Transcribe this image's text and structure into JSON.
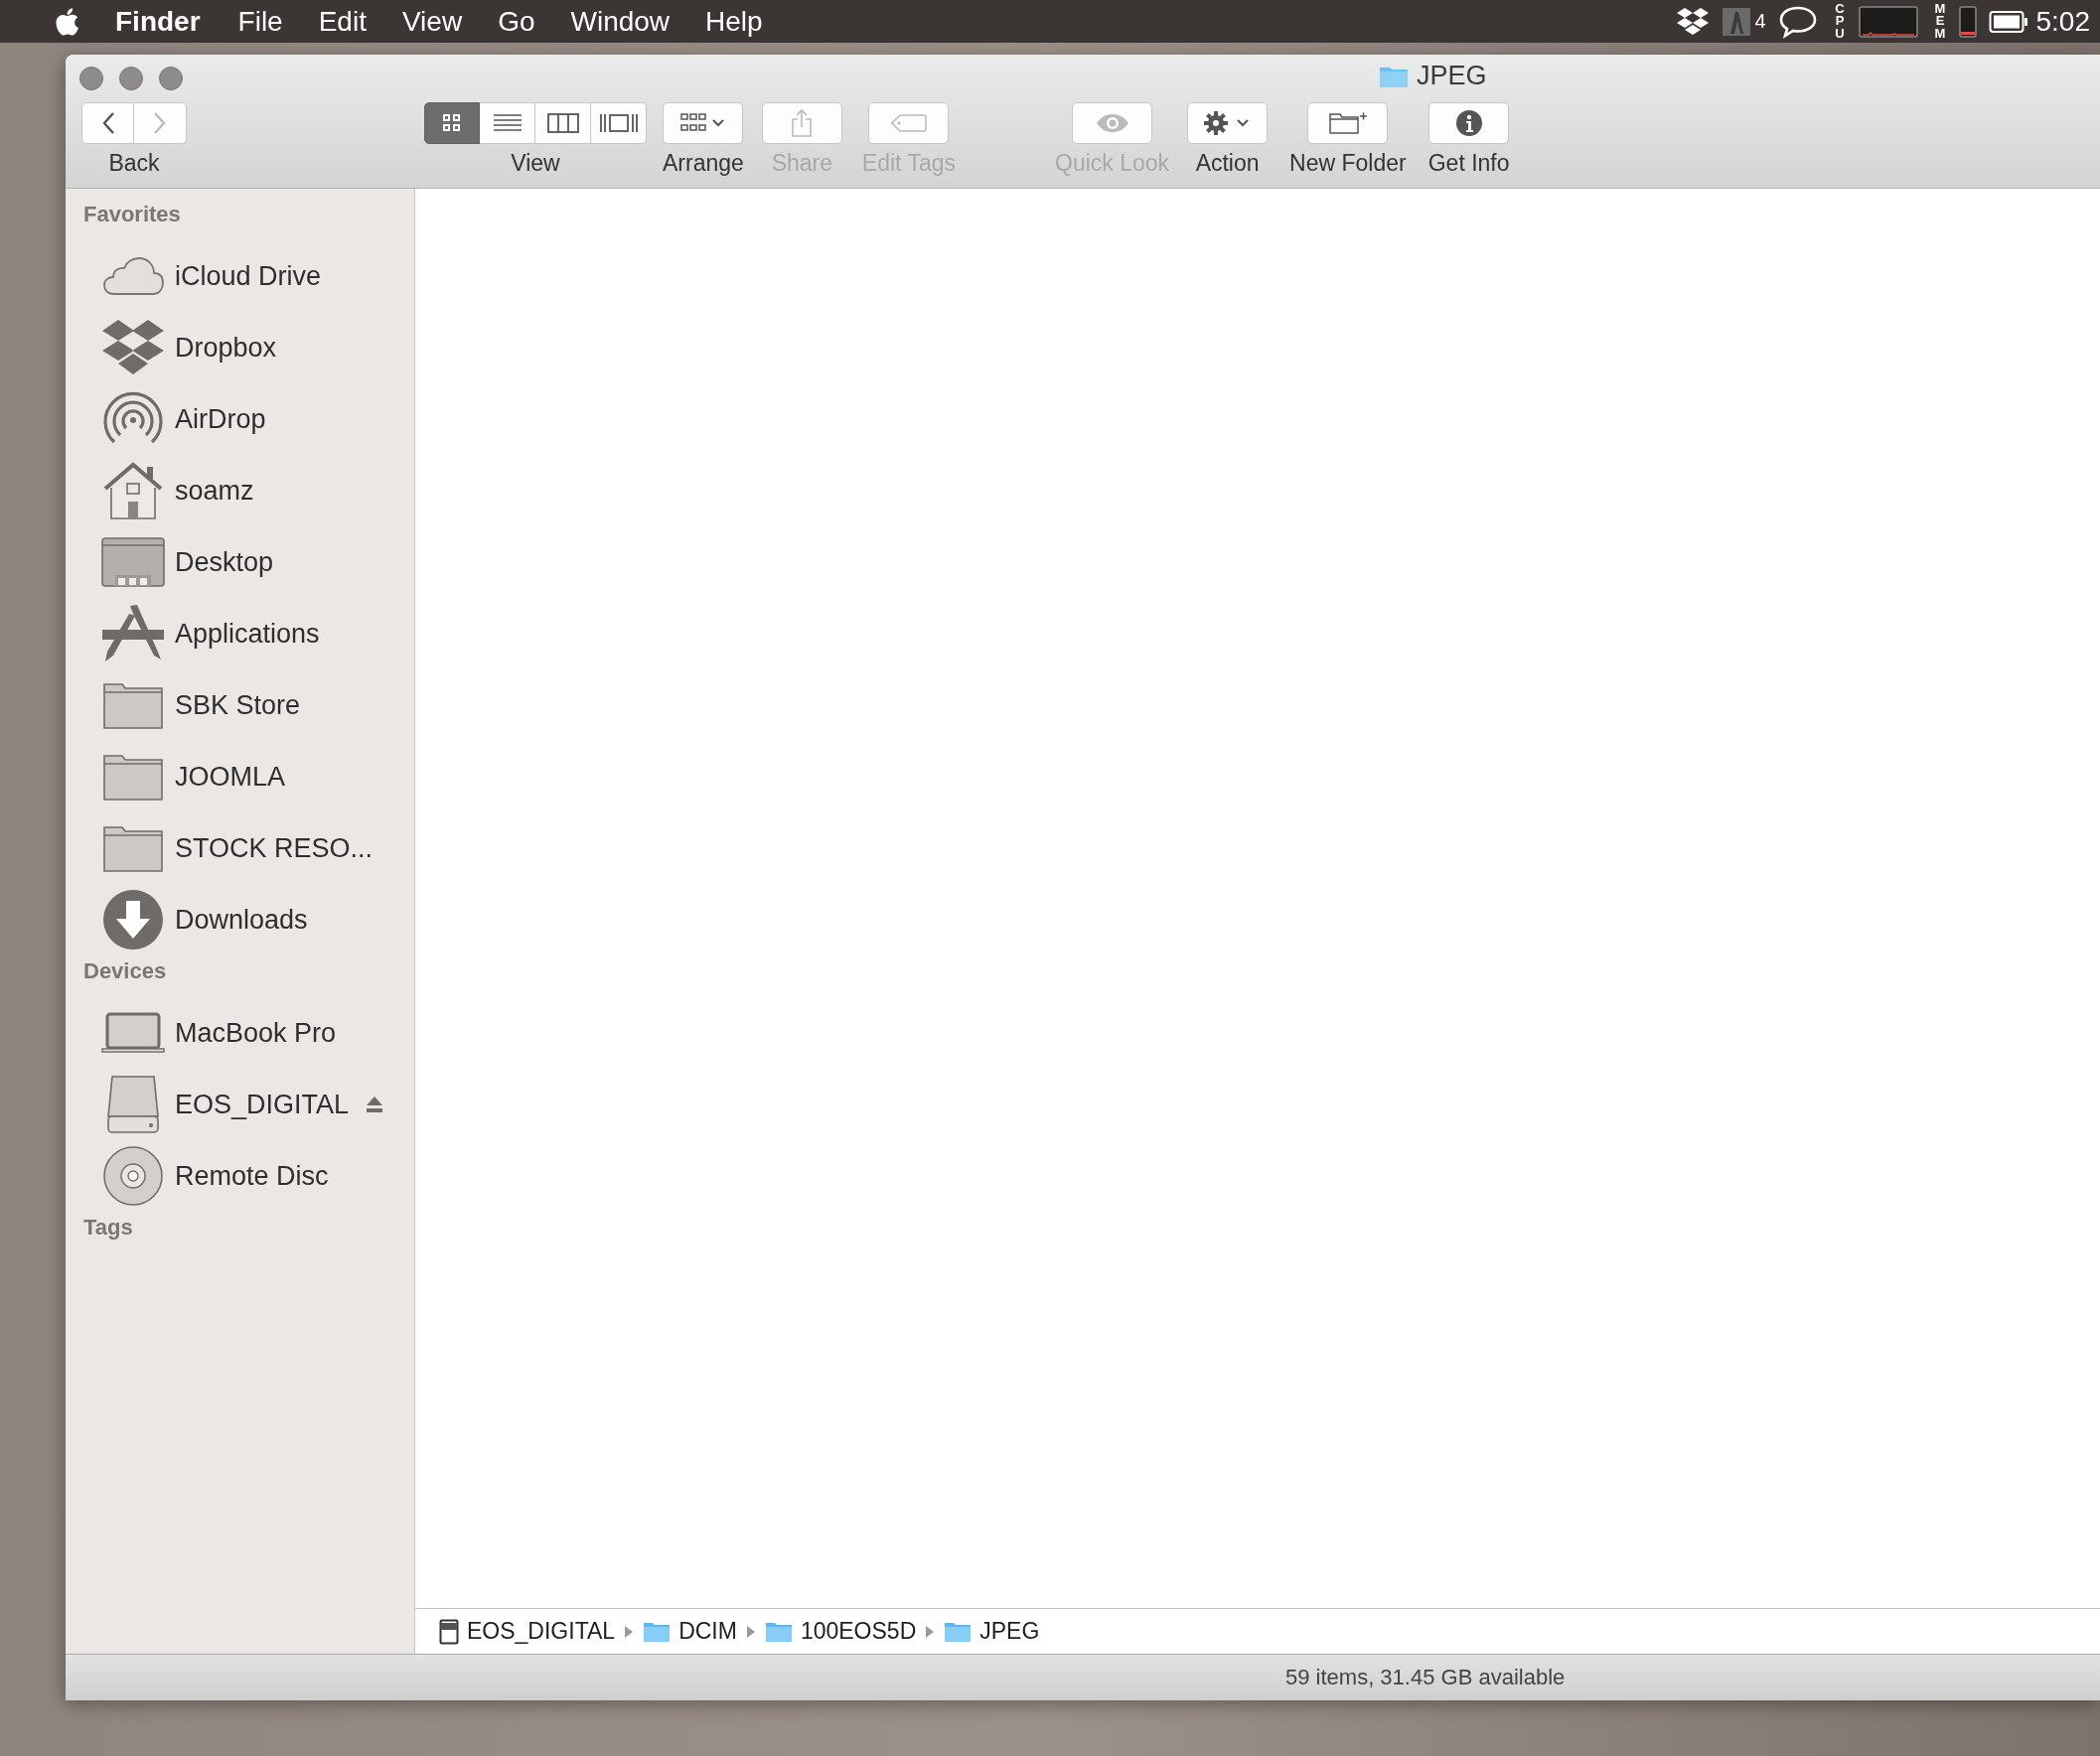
{
  "menu_bar": {
    "app": "Finder",
    "menus": [
      "File",
      "Edit",
      "View",
      "Go",
      "Window",
      "Help"
    ],
    "status_text": "4",
    "cpu_label": "CPU",
    "mem_label": "MEM",
    "clock": "5:02"
  },
  "window": {
    "title": "JPEG"
  },
  "toolbar": {
    "nav_label": "Back",
    "back_disabled": false,
    "forward_disabled": true,
    "view_label": "View",
    "view_modes": [
      {
        "kind": "icons",
        "selected": true
      },
      {
        "kind": "list",
        "selected": false
      },
      {
        "kind": "columns",
        "selected": false
      },
      {
        "kind": "coverflow",
        "selected": false
      }
    ],
    "buttons": [
      {
        "kind": "arrange",
        "label": "Arrange",
        "disabled": false
      },
      {
        "kind": "share",
        "label": "Share",
        "disabled": true
      },
      {
        "kind": "tags",
        "label": "Edit Tags",
        "disabled": true
      },
      {
        "kind": "quicklook",
        "label": "Quick Look",
        "disabled": true
      },
      {
        "kind": "action",
        "label": "Action",
        "disabled": false
      },
      {
        "kind": "newfolder",
        "label": "New Folder",
        "disabled": false
      },
      {
        "kind": "info",
        "label": "Get Info",
        "disabled": false
      }
    ]
  },
  "sidebar": {
    "sections": [
      {
        "title": "Favorites",
        "items": [
          {
            "kind": "cloud",
            "label": "iCloud Drive"
          },
          {
            "kind": "dropbox",
            "label": "Dropbox"
          },
          {
            "kind": "airdrop",
            "label": "AirDrop"
          },
          {
            "kind": "home",
            "label": "soamz"
          },
          {
            "kind": "desktop",
            "label": "Desktop"
          },
          {
            "kind": "apps",
            "label": "Applications"
          },
          {
            "kind": "folder",
            "label": "SBK Store"
          },
          {
            "kind": "folder",
            "label": "JOOMLA"
          },
          {
            "kind": "folder",
            "label": "STOCK RESO..."
          },
          {
            "kind": "downloads",
            "label": "Downloads"
          }
        ]
      },
      {
        "title": "Devices",
        "items": [
          {
            "kind": "laptop",
            "label": "MacBook Pro",
            "ejectable": false
          },
          {
            "kind": "disk",
            "label": "EOS_DIGITAL",
            "ejectable": true
          },
          {
            "kind": "disc",
            "label": "Remote Disc",
            "ejectable": false
          }
        ]
      },
      {
        "title": "Tags"
      }
    ]
  },
  "path_bar": [
    {
      "kind": "drive",
      "label": "EOS_DIGITAL"
    },
    {
      "kind": "folder",
      "label": "DCIM"
    },
    {
      "kind": "folder",
      "label": "100EOS5D"
    },
    {
      "kind": "folder",
      "label": "JPEG"
    }
  ],
  "status_bar": "59 items, 31.45 GB available"
}
